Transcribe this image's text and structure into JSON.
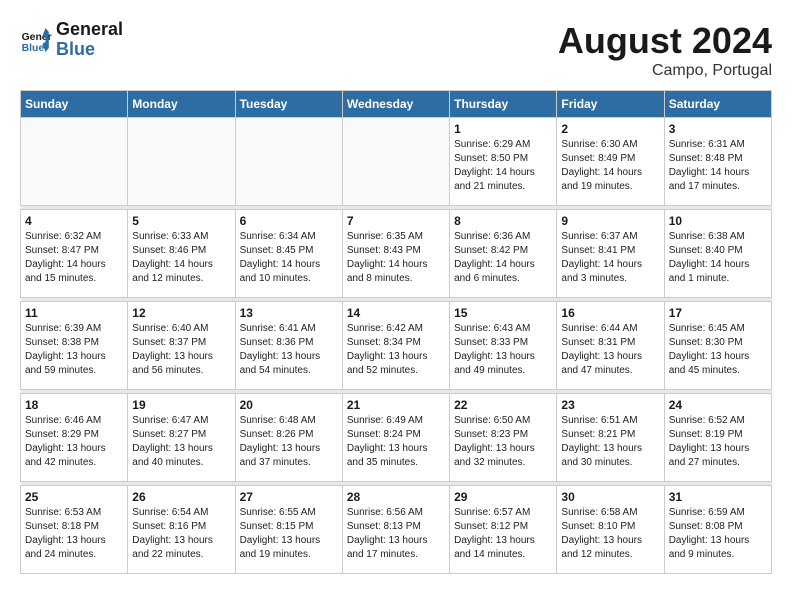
{
  "header": {
    "logo_line1": "General",
    "logo_line2": "Blue",
    "month_year": "August 2024",
    "location": "Campo, Portugal"
  },
  "days_of_week": [
    "Sunday",
    "Monday",
    "Tuesday",
    "Wednesday",
    "Thursday",
    "Friday",
    "Saturday"
  ],
  "weeks": [
    [
      {
        "day": "",
        "info": ""
      },
      {
        "day": "",
        "info": ""
      },
      {
        "day": "",
        "info": ""
      },
      {
        "day": "",
        "info": ""
      },
      {
        "day": "1",
        "info": "Sunrise: 6:29 AM\nSunset: 8:50 PM\nDaylight: 14 hours\nand 21 minutes."
      },
      {
        "day": "2",
        "info": "Sunrise: 6:30 AM\nSunset: 8:49 PM\nDaylight: 14 hours\nand 19 minutes."
      },
      {
        "day": "3",
        "info": "Sunrise: 6:31 AM\nSunset: 8:48 PM\nDaylight: 14 hours\nand 17 minutes."
      }
    ],
    [
      {
        "day": "4",
        "info": "Sunrise: 6:32 AM\nSunset: 8:47 PM\nDaylight: 14 hours\nand 15 minutes."
      },
      {
        "day": "5",
        "info": "Sunrise: 6:33 AM\nSunset: 8:46 PM\nDaylight: 14 hours\nand 12 minutes."
      },
      {
        "day": "6",
        "info": "Sunrise: 6:34 AM\nSunset: 8:45 PM\nDaylight: 14 hours\nand 10 minutes."
      },
      {
        "day": "7",
        "info": "Sunrise: 6:35 AM\nSunset: 8:43 PM\nDaylight: 14 hours\nand 8 minutes."
      },
      {
        "day": "8",
        "info": "Sunrise: 6:36 AM\nSunset: 8:42 PM\nDaylight: 14 hours\nand 6 minutes."
      },
      {
        "day": "9",
        "info": "Sunrise: 6:37 AM\nSunset: 8:41 PM\nDaylight: 14 hours\nand 3 minutes."
      },
      {
        "day": "10",
        "info": "Sunrise: 6:38 AM\nSunset: 8:40 PM\nDaylight: 14 hours\nand 1 minute."
      }
    ],
    [
      {
        "day": "11",
        "info": "Sunrise: 6:39 AM\nSunset: 8:38 PM\nDaylight: 13 hours\nand 59 minutes."
      },
      {
        "day": "12",
        "info": "Sunrise: 6:40 AM\nSunset: 8:37 PM\nDaylight: 13 hours\nand 56 minutes."
      },
      {
        "day": "13",
        "info": "Sunrise: 6:41 AM\nSunset: 8:36 PM\nDaylight: 13 hours\nand 54 minutes."
      },
      {
        "day": "14",
        "info": "Sunrise: 6:42 AM\nSunset: 8:34 PM\nDaylight: 13 hours\nand 52 minutes."
      },
      {
        "day": "15",
        "info": "Sunrise: 6:43 AM\nSunset: 8:33 PM\nDaylight: 13 hours\nand 49 minutes."
      },
      {
        "day": "16",
        "info": "Sunrise: 6:44 AM\nSunset: 8:31 PM\nDaylight: 13 hours\nand 47 minutes."
      },
      {
        "day": "17",
        "info": "Sunrise: 6:45 AM\nSunset: 8:30 PM\nDaylight: 13 hours\nand 45 minutes."
      }
    ],
    [
      {
        "day": "18",
        "info": "Sunrise: 6:46 AM\nSunset: 8:29 PM\nDaylight: 13 hours\nand 42 minutes."
      },
      {
        "day": "19",
        "info": "Sunrise: 6:47 AM\nSunset: 8:27 PM\nDaylight: 13 hours\nand 40 minutes."
      },
      {
        "day": "20",
        "info": "Sunrise: 6:48 AM\nSunset: 8:26 PM\nDaylight: 13 hours\nand 37 minutes."
      },
      {
        "day": "21",
        "info": "Sunrise: 6:49 AM\nSunset: 8:24 PM\nDaylight: 13 hours\nand 35 minutes."
      },
      {
        "day": "22",
        "info": "Sunrise: 6:50 AM\nSunset: 8:23 PM\nDaylight: 13 hours\nand 32 minutes."
      },
      {
        "day": "23",
        "info": "Sunrise: 6:51 AM\nSunset: 8:21 PM\nDaylight: 13 hours\nand 30 minutes."
      },
      {
        "day": "24",
        "info": "Sunrise: 6:52 AM\nSunset: 8:19 PM\nDaylight: 13 hours\nand 27 minutes."
      }
    ],
    [
      {
        "day": "25",
        "info": "Sunrise: 6:53 AM\nSunset: 8:18 PM\nDaylight: 13 hours\nand 24 minutes."
      },
      {
        "day": "26",
        "info": "Sunrise: 6:54 AM\nSunset: 8:16 PM\nDaylight: 13 hours\nand 22 minutes."
      },
      {
        "day": "27",
        "info": "Sunrise: 6:55 AM\nSunset: 8:15 PM\nDaylight: 13 hours\nand 19 minutes."
      },
      {
        "day": "28",
        "info": "Sunrise: 6:56 AM\nSunset: 8:13 PM\nDaylight: 13 hours\nand 17 minutes."
      },
      {
        "day": "29",
        "info": "Sunrise: 6:57 AM\nSunset: 8:12 PM\nDaylight: 13 hours\nand 14 minutes."
      },
      {
        "day": "30",
        "info": "Sunrise: 6:58 AM\nSunset: 8:10 PM\nDaylight: 13 hours\nand 12 minutes."
      },
      {
        "day": "31",
        "info": "Sunrise: 6:59 AM\nSunset: 8:08 PM\nDaylight: 13 hours\nand 9 minutes."
      }
    ]
  ]
}
